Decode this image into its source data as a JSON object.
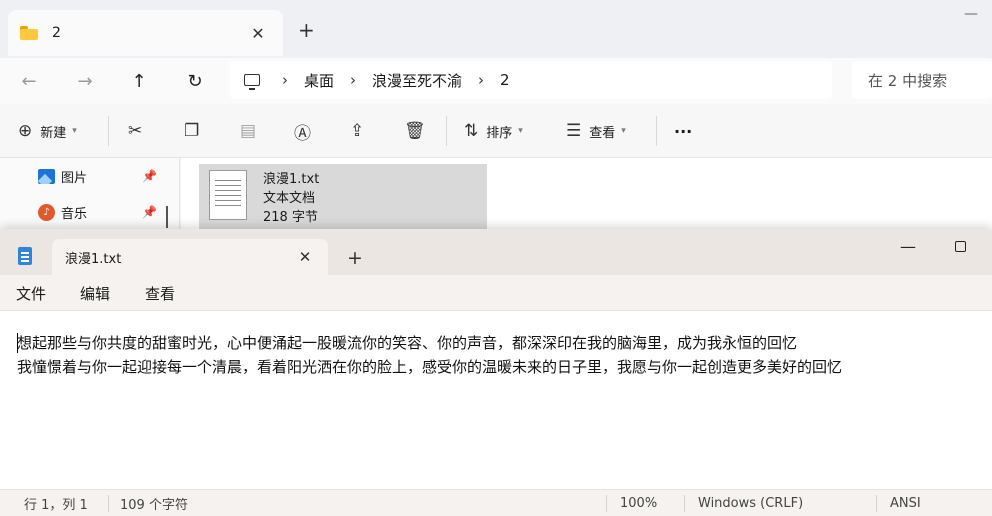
{
  "explorer": {
    "tab_title": "2",
    "tab_close": "✕",
    "new_tab": "+",
    "minimize": "—",
    "nav": {
      "back": "←",
      "forward": "→",
      "up": "↑",
      "refresh": "↻"
    },
    "breadcrumb": [
      "桌面",
      "浪漫至死不渝",
      "2"
    ],
    "breadcrumb_sep": "›",
    "search_placeholder": "在 2 中搜索",
    "toolbar": {
      "new_label": "新建",
      "sort_label": "排序",
      "view_label": "查看",
      "more_label": "···"
    },
    "nav_pane": {
      "items": [
        {
          "label": "图片"
        },
        {
          "label": "音乐"
        }
      ]
    },
    "file": {
      "name": "浪漫1.txt",
      "type": "文本文档",
      "size": "218 字节"
    }
  },
  "notepad": {
    "tab_title": "浪漫1.txt",
    "tab_close": "✕",
    "new_tab": "+",
    "minimize": "—",
    "menu": {
      "file": "文件",
      "edit": "编辑",
      "view": "查看"
    },
    "content": {
      "line1": "想起那些与你共度的甜蜜时光，心中便涌起一股暖流你的笑容、你的声音，都深深印在我的脑海里，成为我永恒的回忆",
      "line2": "我憧憬着与你一起迎接每一个清晨，看着阳光洒在你的脸上，感受你的温暖未来的日子里，我愿与你一起创造更多美好的回忆"
    },
    "status": {
      "position": "行 1，列 1",
      "char_count": "109 个字符",
      "zoom": "100%",
      "line_ending": "Windows (CRLF)",
      "encoding": "ANSI"
    }
  }
}
